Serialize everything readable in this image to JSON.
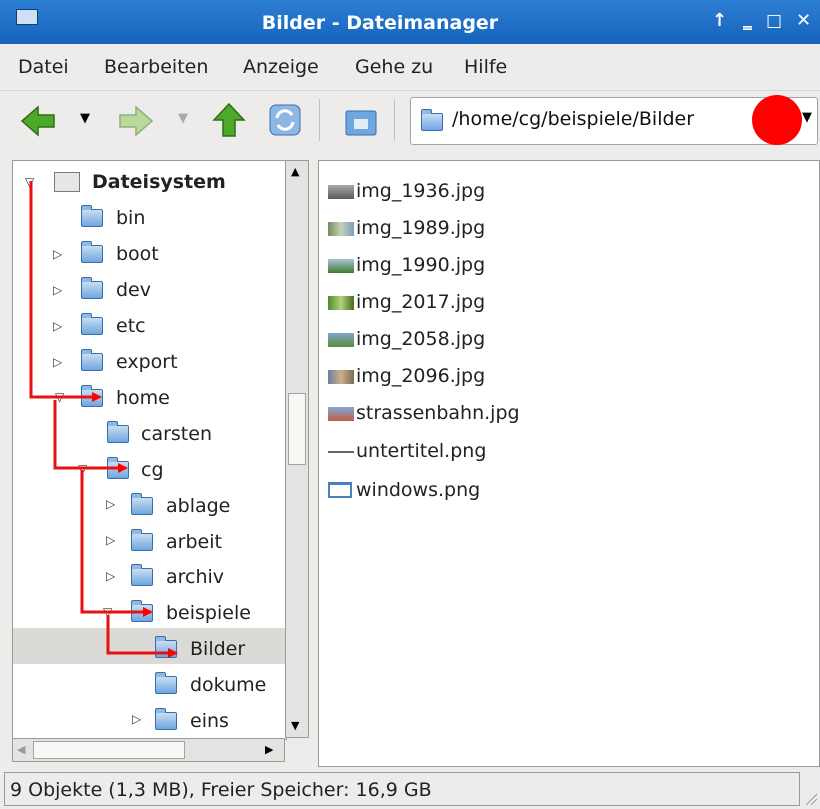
{
  "window": {
    "title": "Bilder - Dateimanager"
  },
  "menu": [
    {
      "label": "Datei"
    },
    {
      "label": "Bearbeiten"
    },
    {
      "label": "Anzeige"
    },
    {
      "label": "Gehe zu"
    },
    {
      "label": "Hilfe"
    }
  ],
  "toolbar": {
    "path": "/home/cg/beispiele/Bilder"
  },
  "tree": [
    {
      "label": "Dateisystem"
    },
    {
      "label": "bin"
    },
    {
      "label": "boot"
    },
    {
      "label": "dev"
    },
    {
      "label": "etc"
    },
    {
      "label": "export"
    },
    {
      "label": "home"
    },
    {
      "label": "carsten"
    },
    {
      "label": "cg"
    },
    {
      "label": "ablage"
    },
    {
      "label": "arbeit"
    },
    {
      "label": "archiv"
    },
    {
      "label": "beispiele"
    },
    {
      "label": "Bilder"
    },
    {
      "label": "dokume"
    },
    {
      "label": "eins"
    }
  ],
  "files": [
    {
      "name": "img_1936.jpg"
    },
    {
      "name": "img_1989.jpg"
    },
    {
      "name": "img_1990.jpg"
    },
    {
      "name": "img_2017.jpg"
    },
    {
      "name": "img_2058.jpg"
    },
    {
      "name": "img_2096.jpg"
    },
    {
      "name": "strassenbahn.jpg"
    },
    {
      "name": "untertitel.png"
    },
    {
      "name": "windows.png"
    }
  ],
  "status": "9 Objekte (1,3 MB), Freier Speicher: 16,9 GB",
  "colors": {
    "titlebar": "#1a6ac4",
    "annotation": "#ff0000"
  }
}
